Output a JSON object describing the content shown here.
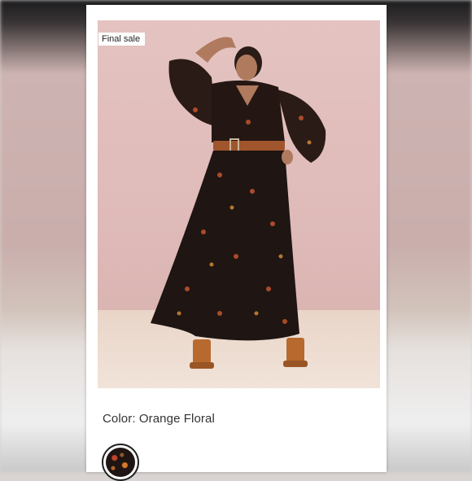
{
  "listing": {
    "badge": "Final sale",
    "color_label": "Color: Orange Floral",
    "swatch_name": "Orange Floral"
  },
  "colors": {
    "backdrop": "#deb9b7",
    "dress": "#1f1512",
    "belt": "#a0552c",
    "shoes": "#b8692d"
  }
}
